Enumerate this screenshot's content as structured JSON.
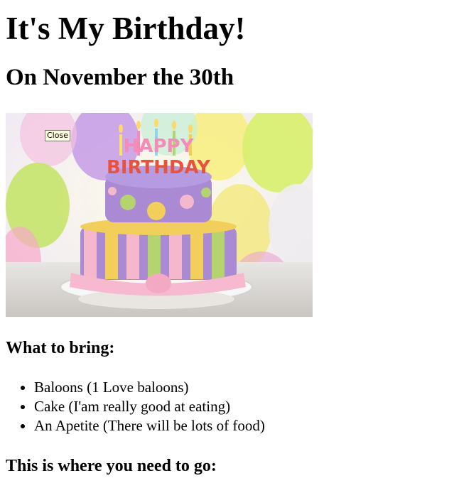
{
  "header": {
    "title": "It's My Birthday!",
    "subtitle": "On November the 30th"
  },
  "photo": {
    "cake_topper": "HAPPY BIRTHDAY",
    "tooltip": "Close"
  },
  "bring": {
    "heading": "What to bring:",
    "items": [
      {
        "label": "Baloons (1 Love baloons)"
      },
      {
        "label": "Cake (I'am really good at eating)"
      },
      {
        "label": "An Apetite (There will be lots of food)"
      }
    ]
  },
  "directions": {
    "heading": "This is where you need to go:"
  },
  "colors": {
    "text": "#000000",
    "background": "#ffffff",
    "tooltip_bg": "#ffffe1",
    "cake_top": "#a98ad3",
    "cake_pink": "#f5b7cc",
    "cake_yellow": "#f2cf5a",
    "cake_green": "#b5d36e"
  }
}
